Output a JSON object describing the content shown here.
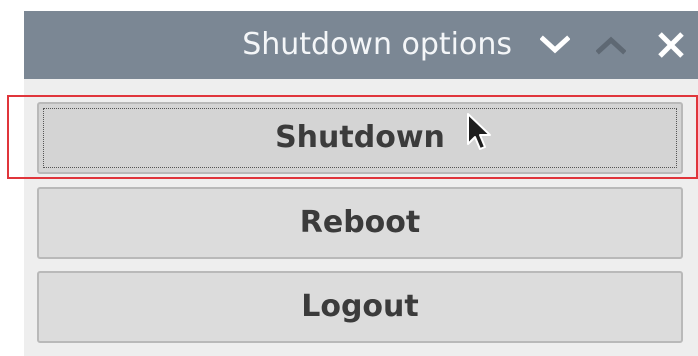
{
  "window": {
    "title": "Shutdown options"
  },
  "titlebar": {
    "buttons": [
      {
        "icon": "chevron-down-icon"
      },
      {
        "icon": "chevron-up-icon"
      },
      {
        "icon": "close-icon"
      }
    ]
  },
  "actions": {
    "shutdown_label": "Shutdown",
    "reboot_label": "Reboot",
    "logout_label": "Logout"
  },
  "colors": {
    "titlebar_bg": "#7b8794",
    "button_bg": "#dcdcdc",
    "highlight": "#e0353b"
  }
}
